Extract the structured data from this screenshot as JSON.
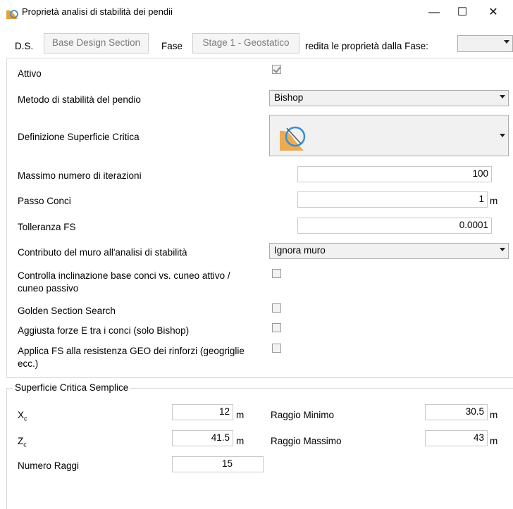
{
  "window": {
    "title": "Proprietà analisi di stabilità dei pendii",
    "minimize_glyph": "—",
    "maximize_glyph": "☐",
    "close_glyph": "✕"
  },
  "header": {
    "ds_label": "D.S.",
    "design_section_button": "Base Design Section",
    "fase_label": "Fase",
    "stage_button": "Stage 1 - Geostatico",
    "inherit_label": "redita le proprietà dalla Fase:",
    "inherit_combo_value": ""
  },
  "props": {
    "attivo_label": "Attivo",
    "attivo_checked": true,
    "metodo_label": "Metodo di stabilità del pendio",
    "metodo_value": "Bishop",
    "superficie_label": "Definizione Superficie Critica",
    "superficie_icon": "critical-surface-circle-icon",
    "iterazioni_label": "Massimo numero di iterazioni",
    "iterazioni_value": "100",
    "passo_label": "Passo Conci",
    "passo_value": "1",
    "passo_unit": "m",
    "tolleranza_label": "Tolleranza FS",
    "tolleranza_value": "0.0001",
    "muro_label": "Contributo del muro all'analisi di stabilità",
    "muro_value": "Ignora muro",
    "inclinazione_label": "Controlla inclinazione base conci vs. cuneo attivo / cuneo passivo",
    "inclinazione_checked": false,
    "golden_label": "Golden Section Search",
    "golden_checked": false,
    "aggiusta_label": "Aggiusta forze E tra i conci (solo Bishop)",
    "aggiusta_checked": false,
    "applica_label": "Applica FS alla resistenza GEO dei rinforzi (geogriglie ecc.)",
    "applica_checked": false
  },
  "surface_group": {
    "title": "Superficie Critica Semplice",
    "xc_label": "Xc",
    "xc_value": "12",
    "xc_unit": "m",
    "zc_label": "Zc",
    "zc_value": "41.5",
    "zc_unit": "m",
    "numero_label": "Numero Raggi",
    "numero_value": "15",
    "raggio_min_label": "Raggio Minimo",
    "raggio_min_value": "30.5",
    "raggio_min_unit": "m",
    "raggio_max_label": "Raggio Massimo",
    "raggio_max_value": "43",
    "raggio_max_unit": "m"
  },
  "colors": {
    "icon_orange": "#e8a03a",
    "icon_blue": "#3a8fd6"
  }
}
